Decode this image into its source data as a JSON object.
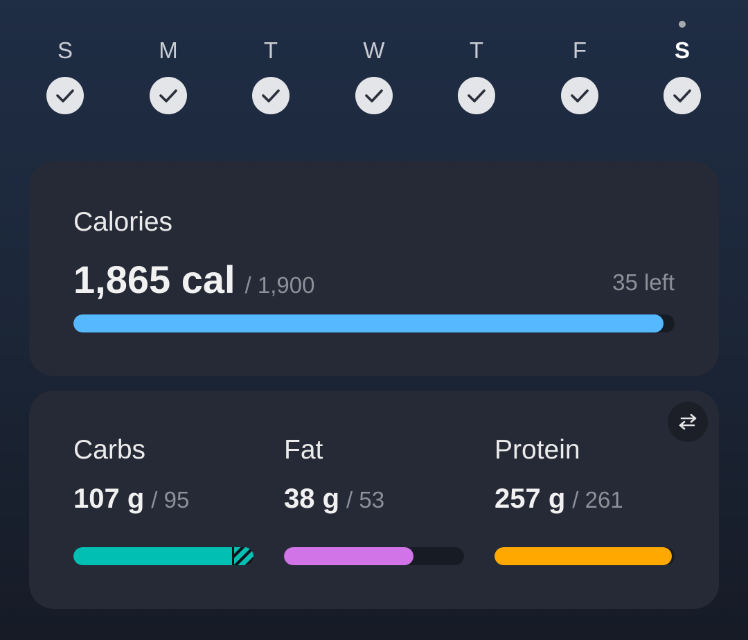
{
  "week": {
    "days": [
      {
        "letter": "S",
        "checked": true,
        "today": false
      },
      {
        "letter": "M",
        "checked": true,
        "today": false
      },
      {
        "letter": "T",
        "checked": true,
        "today": false
      },
      {
        "letter": "W",
        "checked": true,
        "today": false
      },
      {
        "letter": "T",
        "checked": true,
        "today": false
      },
      {
        "letter": "F",
        "checked": true,
        "today": false
      },
      {
        "letter": "S",
        "checked": true,
        "today": true
      }
    ]
  },
  "calories": {
    "title": "Calories",
    "value": "1,865 cal",
    "goal": "/ 1,900",
    "left": "35 left",
    "progress": 0.982,
    "color": "#56b8fe"
  },
  "macros": {
    "swap_icon": "swap-arrows-icon",
    "items": [
      {
        "name": "Carbs",
        "value": "107 g",
        "goal": "/ 95",
        "progress": 1.0,
        "over_fraction": 0.12,
        "color": "#01c0b3"
      },
      {
        "name": "Fat",
        "value": "38 g",
        "goal": "/ 53",
        "progress": 0.72,
        "over_fraction": 0,
        "color": "#d174e7"
      },
      {
        "name": "Protein",
        "value": "257 g",
        "goal": "/ 261",
        "progress": 0.985,
        "over_fraction": 0,
        "color": "#ffa900"
      }
    ]
  }
}
